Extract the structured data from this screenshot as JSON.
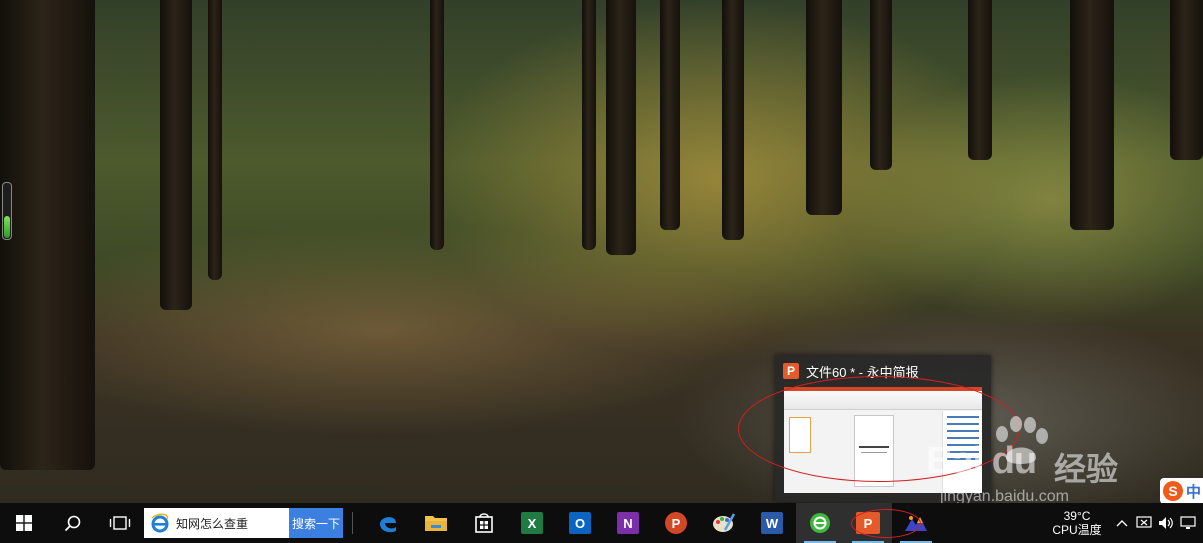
{
  "desktop": {
    "wallpaper": "forest-path-wallpaper"
  },
  "thumbnail": {
    "title": "文件60 * - 永中简报",
    "app_icon": "yozo-presentation-icon",
    "accent": "#e55a2a"
  },
  "watermark": {
    "logo": "Bai du",
    "cn": "经验",
    "url": "jingyan.baidu.com"
  },
  "taskbar": {
    "start_icon": "windows-start-icon",
    "search_icon": "search-icon",
    "taskview_icon": "task-view-icon",
    "browser_search": {
      "text": "知网怎么查重",
      "button": "搜索一下"
    },
    "apps": [
      {
        "name": "edge",
        "icon": "edge-icon",
        "color": "#1f7fd6"
      },
      {
        "name": "file-explorer",
        "icon": "folder-icon",
        "color": "#f2c24b"
      },
      {
        "name": "store",
        "icon": "store-icon",
        "color": "#ffffff"
      },
      {
        "name": "excel",
        "icon": "excel-icon",
        "color": "#1f7a43",
        "letter": "X"
      },
      {
        "name": "outlook",
        "icon": "outlook-icon",
        "color": "#0b64c0",
        "letter": "O"
      },
      {
        "name": "onenote",
        "icon": "onenote-icon",
        "color": "#7b2fa8",
        "letter": "N"
      },
      {
        "name": "powerpoint",
        "icon": "powerpoint-icon",
        "color": "#d24726",
        "letter": "P"
      },
      {
        "name": "paint",
        "icon": "paint-icon",
        "color": "#5aa0e8"
      },
      {
        "name": "word",
        "icon": "word-icon",
        "color": "#2b5aa8",
        "letter": "W"
      },
      {
        "name": "browser-360",
        "icon": "browser-360-icon",
        "color": "#3cb93c"
      },
      {
        "name": "yozo-presentation",
        "icon": "yozo-presentation-icon",
        "color": "#e55a2a",
        "letter": "P"
      },
      {
        "name": "mountain-app",
        "icon": "mountain-app-icon",
        "color": "#3a46c8"
      }
    ]
  },
  "tray": {
    "cpu_value": "39°C",
    "cpu_label": "CPU温度",
    "ime_icon": "sogou-icon",
    "ime_letter": "S",
    "ime_mode": "中"
  }
}
